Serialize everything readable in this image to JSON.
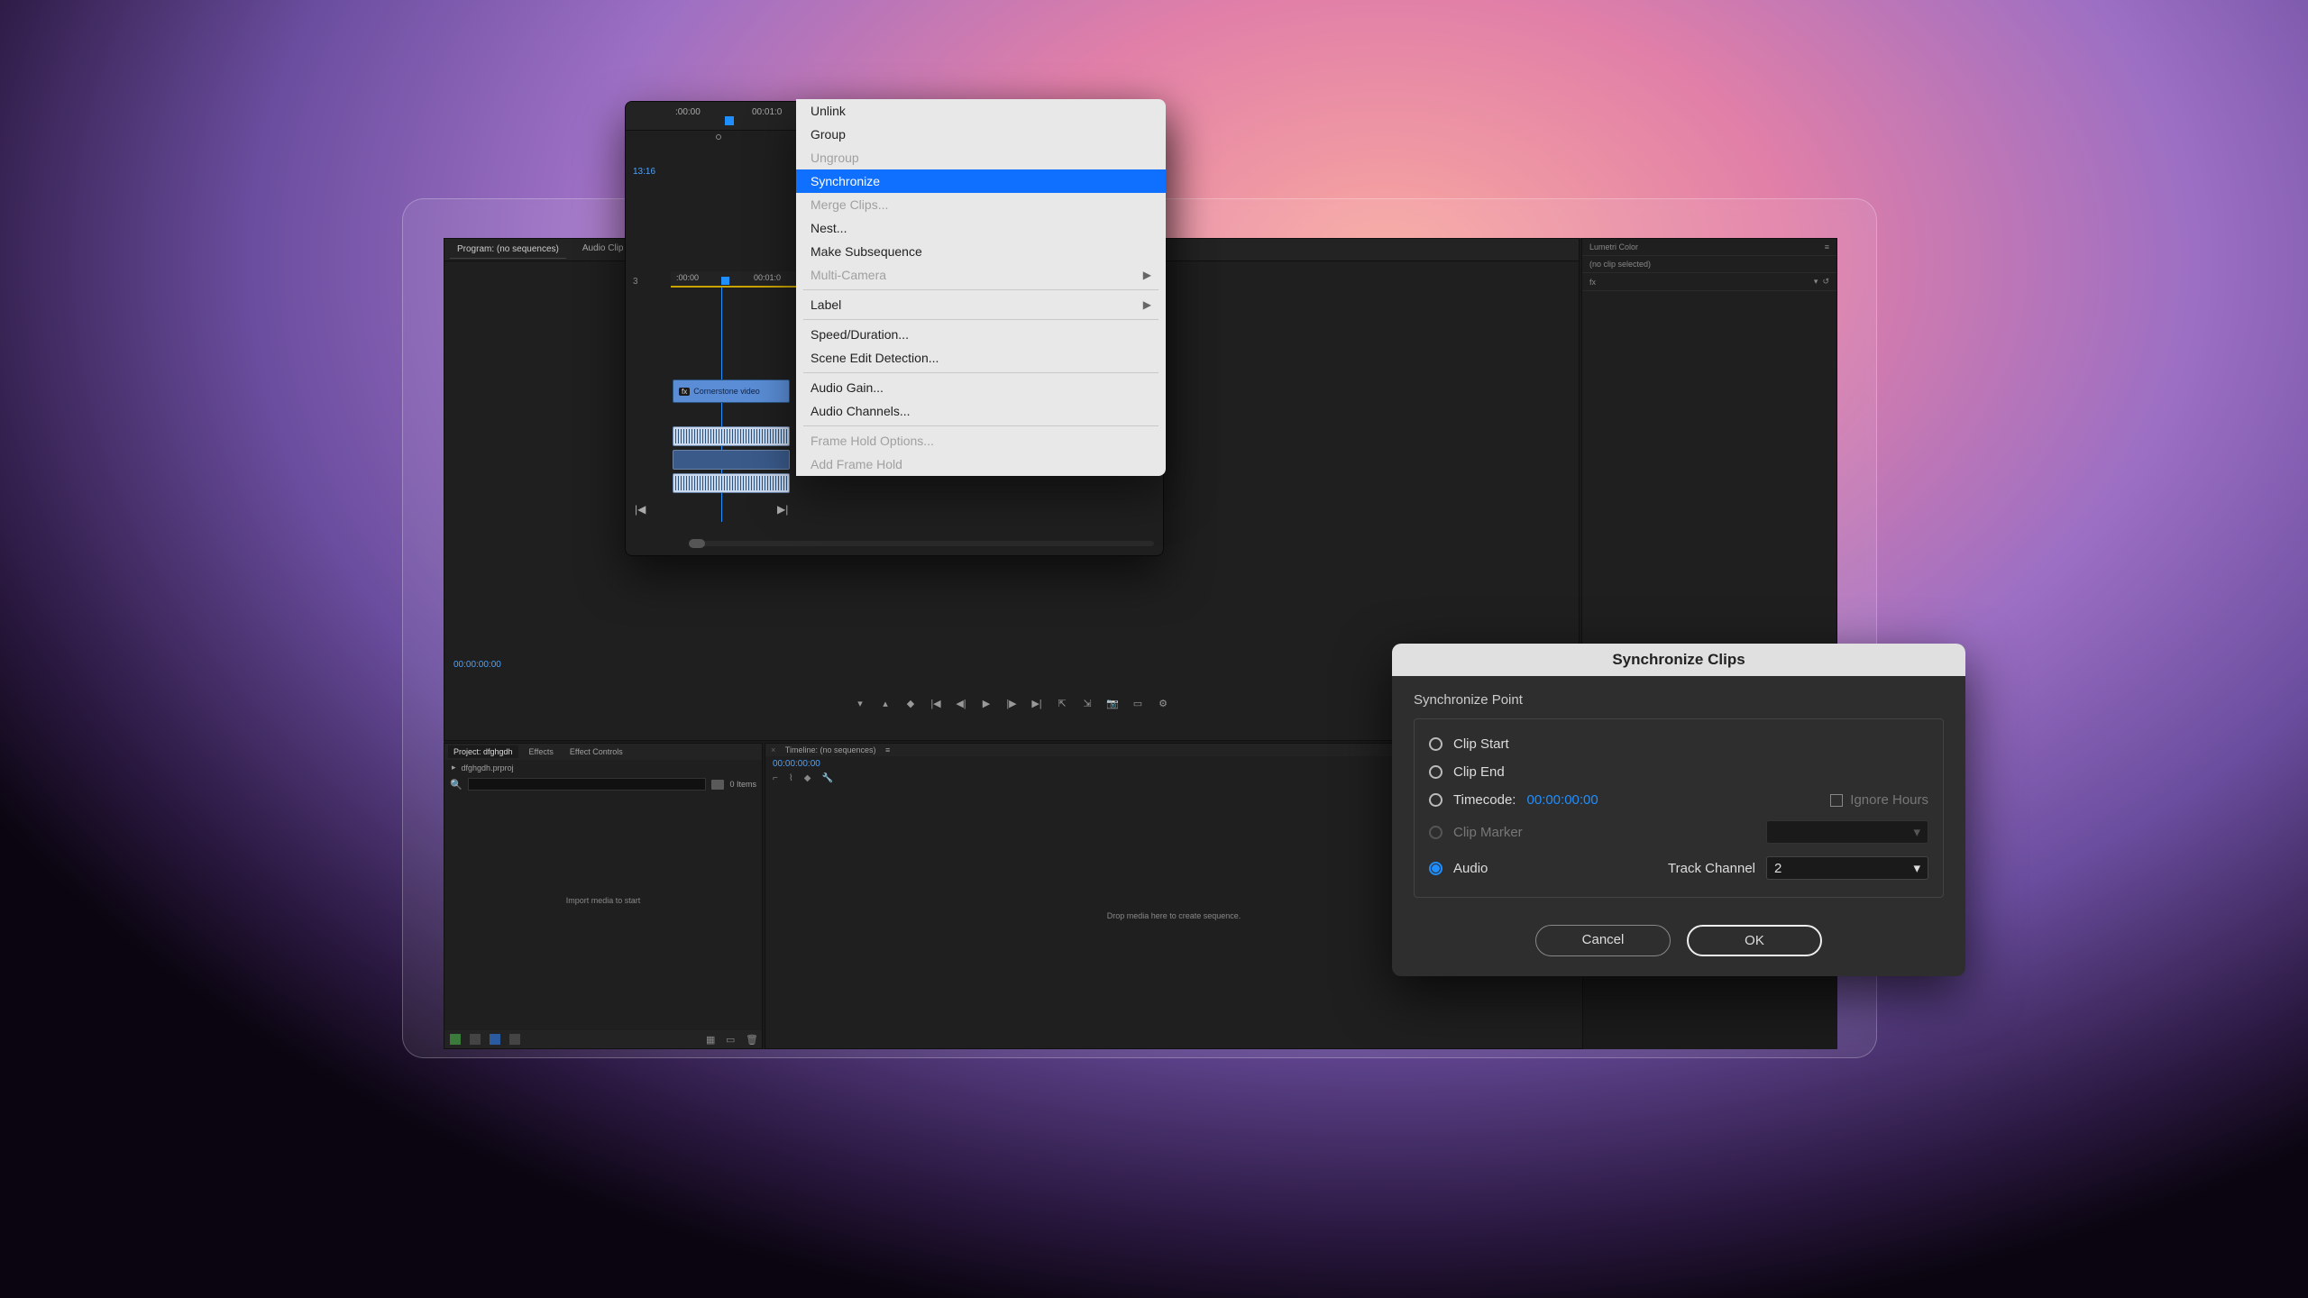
{
  "premiere": {
    "program_panel": {
      "tab1": "Program: (no sequences)",
      "tab2": "Audio Clip Mixer",
      "timecode": "00:00:00:00"
    },
    "lumetri": {
      "title": "Lumetri Color",
      "status": "(no clip selected)",
      "fx_label": "fx"
    },
    "project": {
      "tab_project": "Project: dfghgdh",
      "tab_effects": "Effects",
      "tab_effect_controls": "Effect Controls",
      "bin": "dfghgdh.prproj",
      "items": "0 Items",
      "search_placeholder": "",
      "empty_msg": "Import media to start"
    },
    "timeline_panel": {
      "title": "Timeline: (no sequences)",
      "tc": "00:00:00:00",
      "empty_msg": "Drop media here to create sequence."
    }
  },
  "timeline_overlay": {
    "top_tc": "13:16",
    "ruler_top_a": ":00:00",
    "ruler_top_b": "00:01:0",
    "ruler2_a": ":00:00",
    "ruler2_b": "00:01:0",
    "clip_label": "Cornerstone video",
    "fx": "fx",
    "left_num": "3"
  },
  "context_menu": {
    "items": [
      {
        "label": "Unlink",
        "enabled": true
      },
      {
        "label": "Group",
        "enabled": true
      },
      {
        "label": "Ungroup",
        "enabled": false
      },
      {
        "label": "Synchronize",
        "enabled": true,
        "highlight": true
      },
      {
        "label": "Merge Clips...",
        "enabled": false
      },
      {
        "label": "Nest...",
        "enabled": true
      },
      {
        "label": "Make Subsequence",
        "enabled": true
      },
      {
        "label": "Multi-Camera",
        "enabled": false,
        "submenu": true
      },
      {
        "sep": true
      },
      {
        "label": "Label",
        "enabled": true,
        "submenu": true
      },
      {
        "sep": true
      },
      {
        "label": "Speed/Duration...",
        "enabled": true
      },
      {
        "label": "Scene Edit Detection...",
        "enabled": true
      },
      {
        "sep": true
      },
      {
        "label": "Audio Gain...",
        "enabled": true
      },
      {
        "label": "Audio Channels...",
        "enabled": true
      },
      {
        "sep": true
      },
      {
        "label": "Frame Hold Options...",
        "enabled": false
      },
      {
        "label": "Add Frame Hold",
        "enabled": false
      }
    ]
  },
  "dialog": {
    "title": "Synchronize Clips",
    "section": "Synchronize Point",
    "opt_clip_start": "Clip Start",
    "opt_clip_end": "Clip End",
    "opt_timecode": "Timecode:",
    "timecode_value": "00:00:00:00",
    "ignore_hours": "Ignore Hours",
    "opt_clip_marker": "Clip Marker",
    "opt_audio": "Audio",
    "track_channel_label": "Track Channel",
    "track_channel_value": "2",
    "btn_cancel": "Cancel",
    "btn_ok": "OK"
  }
}
